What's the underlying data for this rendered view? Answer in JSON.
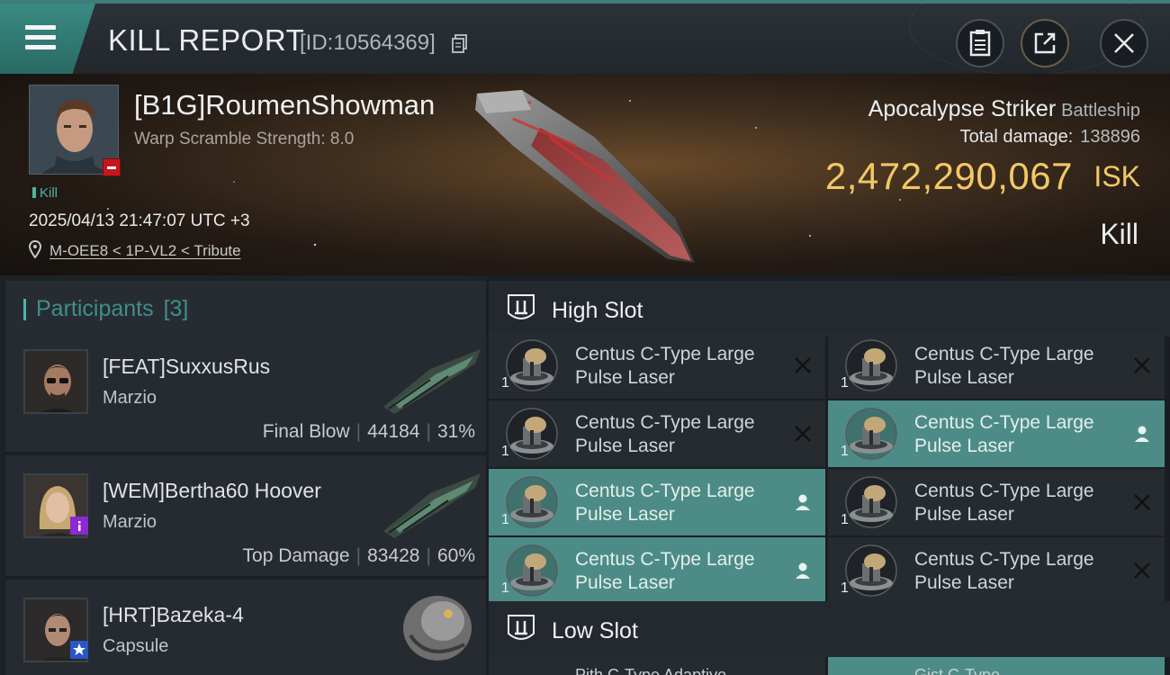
{
  "header": {
    "title": "KILL REPORT",
    "report_id": "[ID:10564369]",
    "icons": {
      "menu": "hamburger-menu-icon",
      "copy": "copy-icon",
      "clipboard": "clipboard-icon",
      "share": "share-icon",
      "close": "close-icon"
    }
  },
  "victim": {
    "name": "[B1G]RoumenShowman",
    "warp_scramble": "Warp Scramble Strength: 8.0",
    "kill_tag": "Kill",
    "datetime": "2025/04/13 21:47:07 UTC +3",
    "location": "M-OEE8 < 1P-VL2 < Tribute",
    "ship_name": "Apocalypse Striker",
    "ship_class": "Battleship",
    "total_damage_label": "Total damage:",
    "total_damage": "138896",
    "isk_value": "2,472,290,067",
    "isk_unit": "ISK",
    "result": "Kill",
    "colors": {
      "isk": "#f2c866",
      "accent": "#4fb3a8",
      "status": "#c4161c"
    }
  },
  "participants": {
    "label": "Participants",
    "count": "[3]",
    "rows": [
      {
        "name": "[FEAT]SuxxusRus",
        "ship": "Marzio",
        "role": "Final Blow",
        "damage": "44184",
        "percent": "31%"
      },
      {
        "name": "[WEM]Bertha60 Hoover",
        "ship": "Marzio",
        "role": "Top Damage",
        "damage": "83428",
        "percent": "60%"
      },
      {
        "name": "[HRT]Bazeka-4",
        "ship": "Capsule"
      }
    ]
  },
  "slots": {
    "high_label": "High Slot",
    "low_label": "Low Slot",
    "high_modules": [
      {
        "line1": "Centus C-Type Large",
        "line2": "Pulse Laser",
        "qty": "1",
        "status": "destroyed"
      },
      {
        "line1": "Centus C-Type Large",
        "line2": "Pulse Laser",
        "qty": "1",
        "status": "destroyed"
      },
      {
        "line1": "Centus C-Type Large",
        "line2": "Pulse Laser",
        "qty": "1",
        "status": "destroyed"
      },
      {
        "line1": "Centus C-Type Large",
        "line2": "Pulse Laser",
        "qty": "1",
        "status": "dropped"
      },
      {
        "line1": "Centus C-Type Large",
        "line2": "Pulse Laser",
        "qty": "1",
        "status": "dropped"
      },
      {
        "line1": "Centus C-Type Large",
        "line2": "Pulse Laser",
        "qty": "1",
        "status": "destroyed"
      },
      {
        "line1": "Centus C-Type Large",
        "line2": "Pulse Laser",
        "qty": "1",
        "status": "dropped"
      },
      {
        "line1": "Centus C-Type Large",
        "line2": "Pulse Laser",
        "qty": "1",
        "status": "destroyed"
      }
    ],
    "low_peek": [
      "Pith C-Type Adaptive",
      "Gist C-Type..."
    ]
  }
}
